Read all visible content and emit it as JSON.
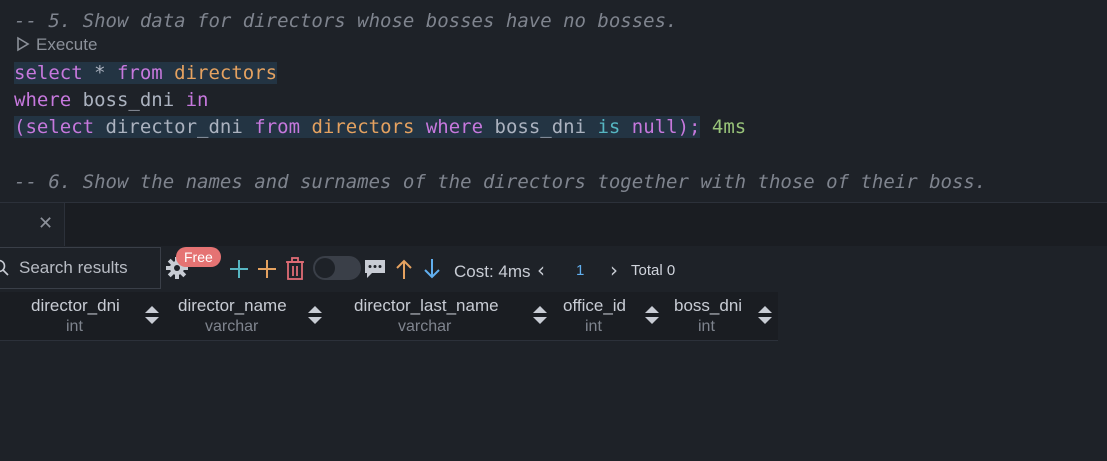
{
  "editor": {
    "comment1": "-- 5. Show data for directors whose bosses have no bosses.",
    "codelens_label": "Execute",
    "line1": {
      "kw_select": "select",
      "star": " * ",
      "kw_from": "from",
      "table": " directors"
    },
    "line2": {
      "kw_where": "where",
      "col": " boss_dni ",
      "kw_in": "in"
    },
    "line3": {
      "open": "(",
      "kw_select": "select",
      "col": " director_dni ",
      "kw_from": "from",
      "table": " directors ",
      "kw_where": "where",
      "col2": " boss_dni ",
      "kw_is": "is",
      "sp": " ",
      "kw_null": "null",
      "close": ");",
      "time": " 4ms"
    },
    "comment2": "-- 6. Show the names and surnames of the directors together with those of their boss."
  },
  "results": {
    "search_placeholder": "Search results",
    "free_badge": "Free",
    "cost_label": "Cost: 4ms",
    "page": "1",
    "total_label": "Total 0",
    "columns": [
      {
        "name": "director_dni",
        "type": "int"
      },
      {
        "name": "director_name",
        "type": "varchar"
      },
      {
        "name": "director_last_name",
        "type": "varchar"
      },
      {
        "name": "office_id",
        "type": "int"
      },
      {
        "name": "boss_dni",
        "type": "int"
      }
    ]
  },
  "icons": [
    "close-icon",
    "search-icon",
    "gear-icon",
    "add-row-icon",
    "insert-icon",
    "delete-icon",
    "toggle",
    "comment-icon",
    "arrow-up-icon",
    "arrow-down-icon",
    "chevron-left-icon",
    "chevron-right-icon",
    "sort-icon"
  ],
  "colors": {
    "background": "#1e2228",
    "keyword": "#c678dd",
    "table": "#e5a260",
    "comment": "#7f848e",
    "time": "#98c379",
    "accent": "#61afef",
    "badge": "#e57373"
  }
}
